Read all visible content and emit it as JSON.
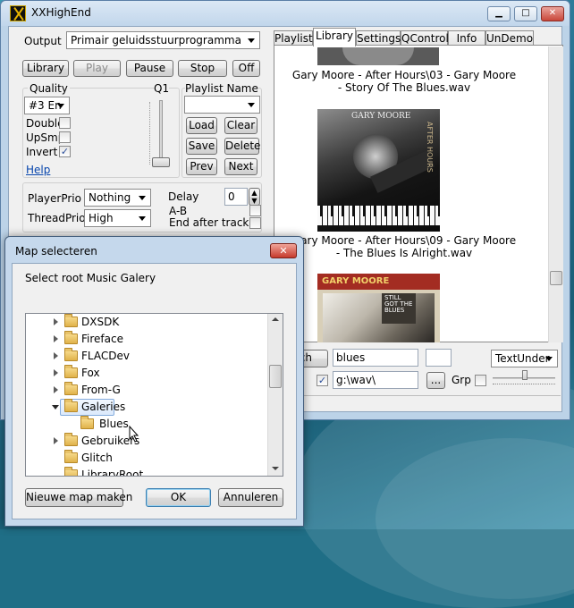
{
  "window": {
    "title": "XXHighEnd",
    "caption_buttons": {
      "minimize": "▁",
      "maximize": "□",
      "close": "✕"
    }
  },
  "output": {
    "label": "Output",
    "device": "Primair geluidsstuurprogramma"
  },
  "transport": {
    "library": "Library",
    "play": "Play",
    "pause": "Pause",
    "stop": "Stop",
    "off": "Off"
  },
  "quality": {
    "label": "Quality",
    "q_label": "Q1",
    "engine_value": "#3 En",
    "double_label": "Double",
    "double_checked": false,
    "upsmp_label": "UpSmp",
    "upsmp_checked": false,
    "invert_label": "Invert",
    "invert_checked": true,
    "help_link": "Help"
  },
  "playlist": {
    "name_label": "Playlist Name",
    "name_value": "",
    "load": "Load",
    "clear": "Clear",
    "save": "Save",
    "delete": "Delete",
    "prev": "Prev",
    "next": "Next"
  },
  "priorities": {
    "player_label": "PlayerPrio",
    "player_value": "Nothing",
    "thread_label": "ThreadPrio",
    "thread_value": "High",
    "delay_label": "Delay",
    "delay_value": "0",
    "ab_label": "A-B",
    "ab_checked": false,
    "end_after_label": "End after track",
    "end_after_checked": false
  },
  "tabs": [
    {
      "label": "Playlist",
      "active": false
    },
    {
      "label": "Library",
      "active": true
    },
    {
      "label": "Settings",
      "active": false
    },
    {
      "label": "QControl",
      "active": false
    },
    {
      "label": "Info",
      "active": false
    },
    {
      "label": "UnDemo",
      "active": false
    }
  ],
  "library": {
    "items": [
      {
        "caption_line1": "Gary Moore - After Hours\\03 - Gary Moore",
        "caption_line2": "- Story Of The Blues.wav"
      },
      {
        "caption_line1": "Gary Moore - After Hours\\09 - Gary Moore",
        "caption_line2": "- The Blues Is Alright.wav",
        "cover_artist": "GARY MOORE",
        "cover_title": "AFTER HOURS"
      },
      {
        "cover_artist": "GARY MOORE",
        "cover_title": "STILL GOT THE BLUES"
      }
    ],
    "search_button": "rch",
    "search_value": "blues",
    "layout_value": "TextUnder",
    "path_checked": true,
    "path_value": "g:\\wav\\",
    "browse_button": "...",
    "grp_label": "Grp",
    "grp_checked": false
  },
  "dialog": {
    "title": "Map selecteren",
    "close": "✕",
    "prompt": "Select root Music Galery",
    "tree": [
      {
        "label": "DXSDK",
        "expand": "closed",
        "level": 0,
        "selected": false
      },
      {
        "label": "Fireface",
        "expand": "closed",
        "level": 0,
        "selected": false
      },
      {
        "label": "FLACDev",
        "expand": "closed",
        "level": 0,
        "selected": false
      },
      {
        "label": "Fox",
        "expand": "closed",
        "level": 0,
        "selected": false
      },
      {
        "label": "From-G",
        "expand": "closed",
        "level": 0,
        "selected": false
      },
      {
        "label": "Galeries",
        "expand": "open",
        "level": 0,
        "selected": true
      },
      {
        "label": "Blues",
        "expand": "none",
        "level": 1,
        "selected": false
      },
      {
        "label": "Gebruikers",
        "expand": "closed",
        "level": 0,
        "selected": false
      },
      {
        "label": "Glitch",
        "expand": "none",
        "level": 0,
        "selected": false
      },
      {
        "label": "LibraryRoot",
        "expand": "none",
        "level": 0,
        "selected": false
      }
    ],
    "new_folder": "Nieuwe map maken",
    "ok": "OK",
    "cancel": "Annuleren"
  }
}
